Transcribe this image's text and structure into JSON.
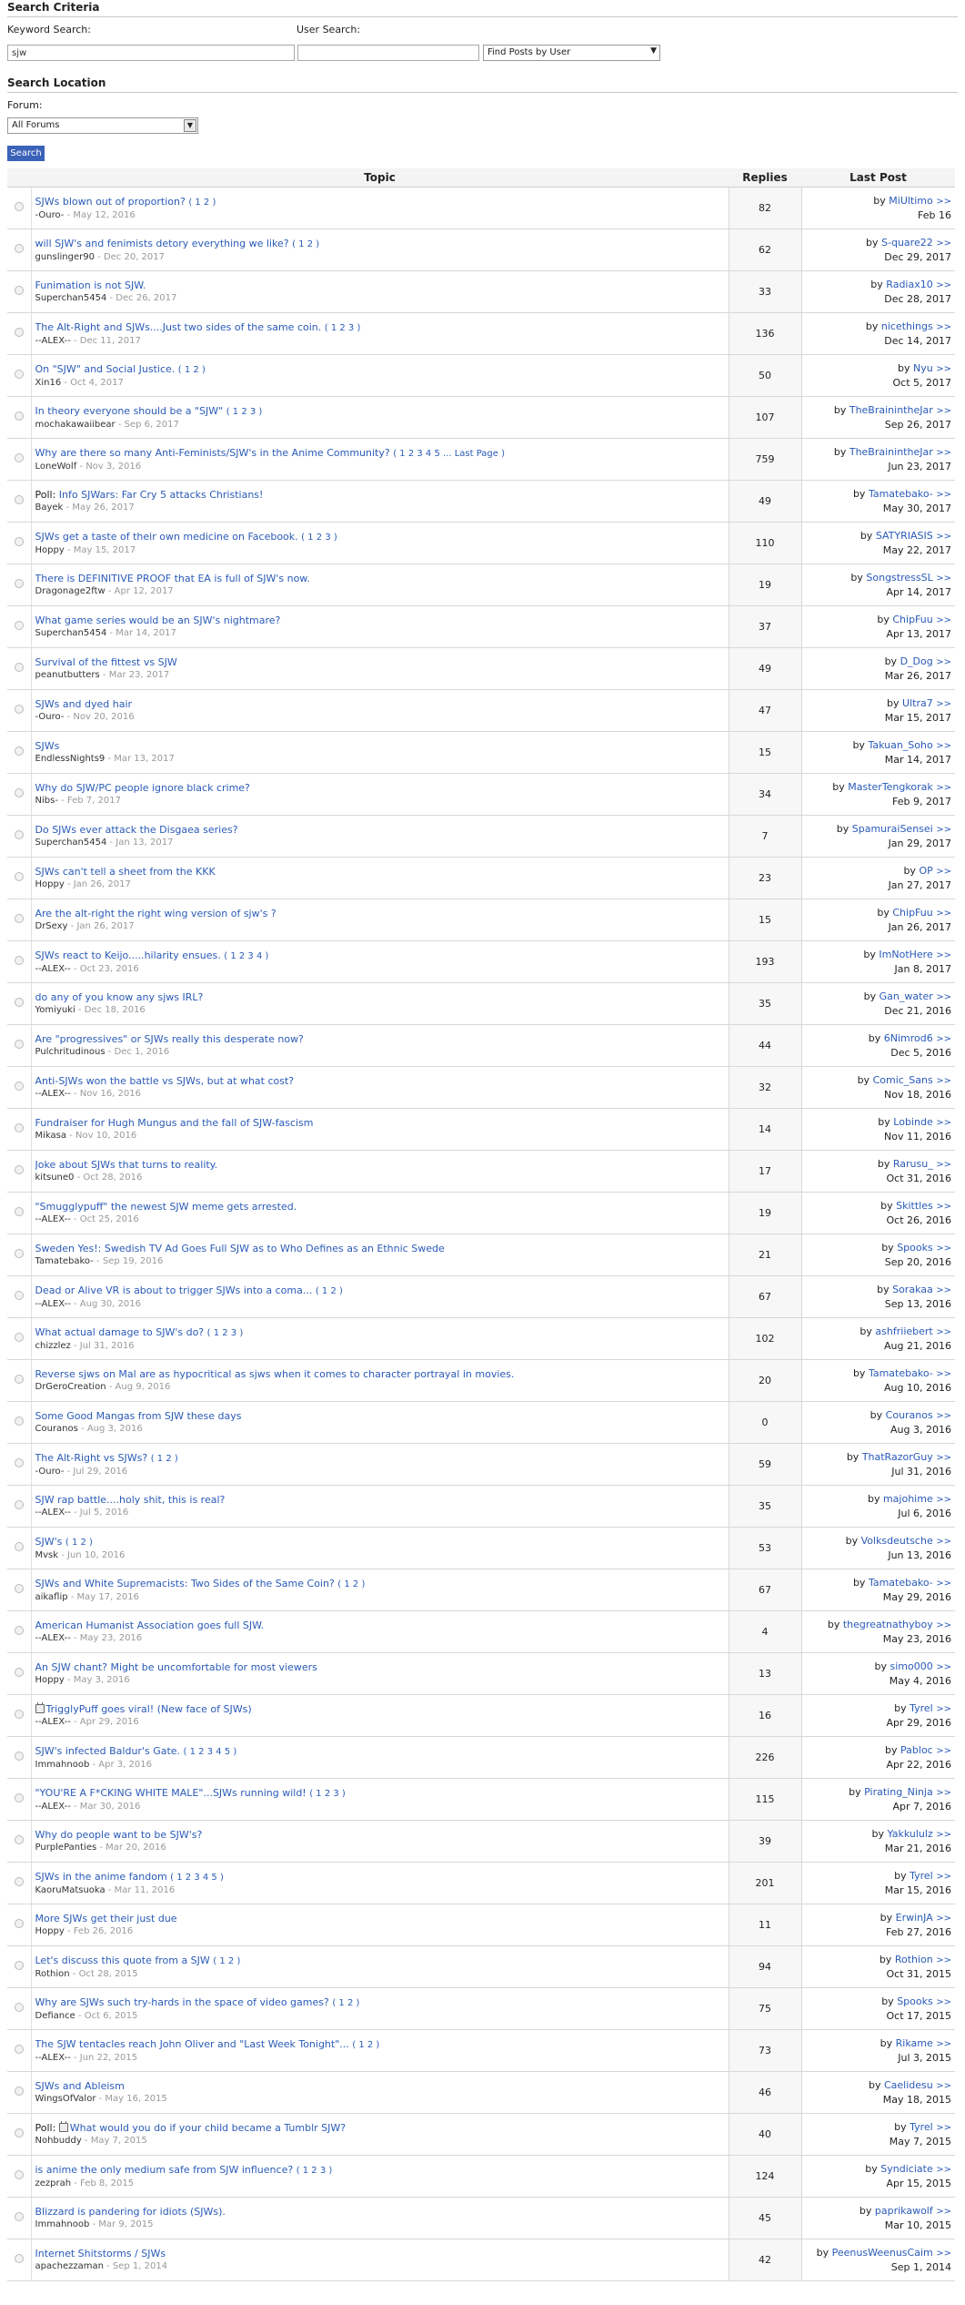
{
  "search": {
    "criteria_title": "Search Criteria",
    "keyword_label": "Keyword Search:",
    "keyword_value": "sjw",
    "user_label": "User Search:",
    "user_value": "",
    "mode_selected": "Find Posts by User",
    "location_title": "Search Location",
    "forum_label": "Forum:",
    "forum_selected": "All Forums",
    "button": "Search"
  },
  "table": {
    "headers": {
      "topic": "Topic",
      "replies": "Replies",
      "last_post": "Last Post"
    }
  },
  "topics": [
    {
      "prefix": "",
      "locked": false,
      "title": "SJWs blown out of proportion?",
      "pages": "( 1 2 )",
      "author": "-Ouro-",
      "date": "May 12, 2016",
      "replies": "82",
      "last_user": "MiUltimo",
      "last_date": "Feb 16"
    },
    {
      "prefix": "",
      "locked": false,
      "title": "will SJW's and fenimists detory everything we like?",
      "pages": "( 1 2 )",
      "author": "gunslinger90",
      "date": "Dec 20, 2017",
      "replies": "62",
      "last_user": "S-quare22",
      "last_date": "Dec 29, 2017"
    },
    {
      "prefix": "",
      "locked": false,
      "title": "Funimation is not SJW.",
      "pages": "",
      "author": "Superchan5454",
      "date": "Dec 26, 2017",
      "replies": "33",
      "last_user": "Radiax10",
      "last_date": "Dec 28, 2017"
    },
    {
      "prefix": "",
      "locked": false,
      "title": "The Alt-Right and SJWs....Just two sides of the same coin.",
      "pages": "( 1 2 3 )",
      "author": "--ALEX--",
      "date": "Dec 11, 2017",
      "replies": "136",
      "last_user": "nicethings",
      "last_date": "Dec 14, 2017"
    },
    {
      "prefix": "",
      "locked": false,
      "title": "On \"SJW\" and Social Justice.",
      "pages": "( 1 2 )",
      "author": "Xin16",
      "date": "Oct 4, 2017",
      "replies": "50",
      "last_user": "Nyu",
      "last_date": "Oct 5, 2017"
    },
    {
      "prefix": "",
      "locked": false,
      "title": "In theory everyone should be a \"SJW\"",
      "pages": "( 1 2 3 )",
      "author": "mochakawaiibear",
      "date": "Sep 6, 2017",
      "replies": "107",
      "last_user": "TheBrainintheJar",
      "last_date": "Sep 26, 2017"
    },
    {
      "prefix": "",
      "locked": false,
      "title": "Why are there so many Anti-Feminists/SJW's in the Anime Community?",
      "pages": "( 1 2 3 4 5 ... Last Page )",
      "author": "LoneWolf",
      "date": "Nov 3, 2016",
      "replies": "759",
      "last_user": "TheBrainintheJar",
      "last_date": "Jun 23, 2017"
    },
    {
      "prefix": "Poll:",
      "locked": false,
      "title": "Info SJWars: Far Cry 5 attacks Christians!",
      "pages": "",
      "author": "Bayek",
      "date": "May 26, 2017",
      "replies": "49",
      "last_user": "Tamatebako-",
      "last_date": "May 30, 2017"
    },
    {
      "prefix": "",
      "locked": false,
      "title": "SJWs get a taste of their own medicine on Facebook.",
      "pages": "( 1 2 3 )",
      "author": "Hoppy",
      "date": "May 15, 2017",
      "replies": "110",
      "last_user": "SATYRIASIS",
      "last_date": "May 22, 2017"
    },
    {
      "prefix": "",
      "locked": false,
      "title": "There is DEFINITIVE PROOF that EA is full of SJW's now.",
      "pages": "",
      "author": "Dragonage2ftw",
      "date": "Apr 12, 2017",
      "replies": "19",
      "last_user": "SongstressSL",
      "last_date": "Apr 14, 2017"
    },
    {
      "prefix": "",
      "locked": false,
      "title": "What game series would be an SJW's nightmare?",
      "pages": "",
      "author": "Superchan5454",
      "date": "Mar 14, 2017",
      "replies": "37",
      "last_user": "ChipFuu",
      "last_date": "Apr 13, 2017"
    },
    {
      "prefix": "",
      "locked": false,
      "title": "Survival of the fittest vs SJW",
      "pages": "",
      "author": "peanutbutters",
      "date": "Mar 23, 2017",
      "replies": "49",
      "last_user": "D_Dog",
      "last_date": "Mar 26, 2017"
    },
    {
      "prefix": "",
      "locked": false,
      "title": "SJWs and dyed hair",
      "pages": "",
      "author": "-Ouro-",
      "date": "Nov 20, 2016",
      "replies": "47",
      "last_user": "Ultra7",
      "last_date": "Mar 15, 2017"
    },
    {
      "prefix": "",
      "locked": false,
      "title": "SJWs",
      "pages": "",
      "author": "EndlessNights9",
      "date": "Mar 13, 2017",
      "replies": "15",
      "last_user": "Takuan_Soho",
      "last_date": "Mar 14, 2017"
    },
    {
      "prefix": "",
      "locked": false,
      "title": "Why do SJW/PC people ignore black crime?",
      "pages": "",
      "author": "Nibs-",
      "date": "Feb 7, 2017",
      "replies": "34",
      "last_user": "MasterTengkorak",
      "last_date": "Feb 9, 2017"
    },
    {
      "prefix": "",
      "locked": false,
      "title": "Do SJWs ever attack the Disgaea series?",
      "pages": "",
      "author": "Superchan5454",
      "date": "Jan 13, 2017",
      "replies": "7",
      "last_user": "SpamuraiSensei",
      "last_date": "Jan 29, 2017"
    },
    {
      "prefix": "",
      "locked": false,
      "title": "SJWs can't tell a sheet from the KKK",
      "pages": "",
      "author": "Hoppy",
      "date": "Jan 26, 2017",
      "replies": "23",
      "last_user": "OP",
      "last_date": "Jan 27, 2017"
    },
    {
      "prefix": "",
      "locked": false,
      "title": "Are the alt-right the right wing version of sjw's ?",
      "pages": "",
      "author": "DrSexy",
      "date": "Jan 26, 2017",
      "replies": "15",
      "last_user": "ChipFuu",
      "last_date": "Jan 26, 2017"
    },
    {
      "prefix": "",
      "locked": false,
      "title": "SJWs react to Keijo.....hilarity ensues.",
      "pages": "( 1 2 3 4 )",
      "author": "--ALEX--",
      "date": "Oct 23, 2016",
      "replies": "193",
      "last_user": "ImNotHere",
      "last_date": "Jan 8, 2017"
    },
    {
      "prefix": "",
      "locked": false,
      "title": "do any of you know any sjws IRL?",
      "pages": "",
      "author": "Yomiyuki",
      "date": "Dec 18, 2016",
      "replies": "35",
      "last_user": "Gan_water",
      "last_date": "Dec 21, 2016"
    },
    {
      "prefix": "",
      "locked": false,
      "title": "Are \"progressives\" or SJWs really this desperate now?",
      "pages": "",
      "author": "Pulchritudinous",
      "date": "Dec 1, 2016",
      "replies": "44",
      "last_user": "6Nimrod6",
      "last_date": "Dec 5, 2016"
    },
    {
      "prefix": "",
      "locked": false,
      "title": "Anti-SJWs won the battle vs SJWs, but at what cost?",
      "pages": "",
      "author": "--ALEX--",
      "date": "Nov 16, 2016",
      "replies": "32",
      "last_user": "Comic_Sans",
      "last_date": "Nov 18, 2016"
    },
    {
      "prefix": "",
      "locked": false,
      "title": "Fundraiser for Hugh Mungus and the fall of SJW-fascism",
      "pages": "",
      "author": "Mikasa",
      "date": "Nov 10, 2016",
      "replies": "14",
      "last_user": "Lobinde",
      "last_date": "Nov 11, 2016"
    },
    {
      "prefix": "",
      "locked": false,
      "title": "Joke about SJWs that turns to reality.",
      "pages": "",
      "author": "kitsune0",
      "date": "Oct 28, 2016",
      "replies": "17",
      "last_user": "Rarusu_",
      "last_date": "Oct 31, 2016"
    },
    {
      "prefix": "",
      "locked": false,
      "title": "\"Smugglypuff\" the newest SJW meme gets arrested.",
      "pages": "",
      "author": "--ALEX--",
      "date": "Oct 25, 2016",
      "replies": "19",
      "last_user": "Skittles",
      "last_date": "Oct 26, 2016"
    },
    {
      "prefix": "",
      "locked": false,
      "title": "Sweden Yes!: Swedish TV Ad Goes Full SJW as to Who Defines as an Ethnic Swede",
      "pages": "",
      "author": "Tamatebako-",
      "date": "Sep 19, 2016",
      "replies": "21",
      "last_user": "Spooks",
      "last_date": "Sep 20, 2016"
    },
    {
      "prefix": "",
      "locked": false,
      "title": "Dead or Alive VR is about to trigger SJWs into a coma...",
      "pages": "( 1 2 )",
      "author": "--ALEX--",
      "date": "Aug 30, 2016",
      "replies": "67",
      "last_user": "Sorakaa",
      "last_date": "Sep 13, 2016"
    },
    {
      "prefix": "",
      "locked": false,
      "title": "What actual damage to SJW's do?",
      "pages": "( 1 2 3 )",
      "author": "chizzlez",
      "date": "Jul 31, 2016",
      "replies": "102",
      "last_user": "ashfriiebert",
      "last_date": "Aug 21, 2016"
    },
    {
      "prefix": "",
      "locked": false,
      "title": "Reverse sjws on Mal are as hypocritical as sjws when it comes to character portrayal in movies.",
      "pages": "",
      "author": "DrGeroCreation",
      "date": "Aug 9, 2016",
      "replies": "20",
      "last_user": "Tamatebako-",
      "last_date": "Aug 10, 2016"
    },
    {
      "prefix": "",
      "locked": false,
      "title": "Some Good Mangas from SJW these days",
      "pages": "",
      "author": "Couranos",
      "date": "Aug 3, 2016",
      "replies": "0",
      "last_user": "Couranos",
      "last_date": "Aug 3, 2016"
    },
    {
      "prefix": "",
      "locked": false,
      "title": "The Alt-Right vs SJWs?",
      "pages": "( 1 2 )",
      "author": "-Ouro-",
      "date": "Jul 29, 2016",
      "replies": "59",
      "last_user": "ThatRazorGuy",
      "last_date": "Jul 31, 2016"
    },
    {
      "prefix": "",
      "locked": false,
      "title": "SJW rap battle....holy shit, this is real?",
      "pages": "",
      "author": "--ALEX--",
      "date": "Jul 5, 2016",
      "replies": "35",
      "last_user": "majohime",
      "last_date": "Jul 6, 2016"
    },
    {
      "prefix": "",
      "locked": false,
      "title": "SJW's",
      "pages": "( 1 2 )",
      "author": "Mvsk",
      "date": "Jun 10, 2016",
      "replies": "53",
      "last_user": "Volksdeutsche",
      "last_date": "Jun 13, 2016"
    },
    {
      "prefix": "",
      "locked": false,
      "title": "SJWs and White Supremacists: Two Sides of the Same Coin?",
      "pages": "( 1 2 )",
      "author": "aikaflip",
      "date": "May 17, 2016",
      "replies": "67",
      "last_user": "Tamatebako-",
      "last_date": "May 29, 2016"
    },
    {
      "prefix": "",
      "locked": false,
      "title": "American Humanist Association goes full SJW.",
      "pages": "",
      "author": "--ALEX--",
      "date": "May 23, 2016",
      "replies": "4",
      "last_user": "thegreatnathyboy",
      "last_date": "May 23, 2016"
    },
    {
      "prefix": "",
      "locked": false,
      "title": "An SJW chant? Might be uncomfortable for most viewers",
      "pages": "",
      "author": "Hoppy",
      "date": "May 3, 2016",
      "replies": "13",
      "last_user": "simo000",
      "last_date": "May 4, 2016"
    },
    {
      "prefix": "",
      "locked": true,
      "title": "TrigglyPuff goes viral! (New face of SJWs)",
      "pages": "",
      "author": "--ALEX--",
      "date": "Apr 29, 2016",
      "replies": "16",
      "last_user": "Tyrel",
      "last_date": "Apr 29, 2016"
    },
    {
      "prefix": "",
      "locked": false,
      "title": "SJW's infected Baldur's Gate.",
      "pages": "( 1 2 3 4 5 )",
      "author": "Immahnoob",
      "date": "Apr 3, 2016",
      "replies": "226",
      "last_user": "Pabloc",
      "last_date": "Apr 22, 2016"
    },
    {
      "prefix": "",
      "locked": false,
      "title": "\"YOU'RE A F*CKING WHITE MALE\"...SJWs running wild!",
      "pages": "( 1 2 3 )",
      "author": "--ALEX--",
      "date": "Mar 30, 2016",
      "replies": "115",
      "last_user": "Pirating_Ninja",
      "last_date": "Apr 7, 2016"
    },
    {
      "prefix": "",
      "locked": false,
      "title": "Why do people want to be SJW's?",
      "pages": "",
      "author": "PurplePanties",
      "date": "Mar 20, 2016",
      "replies": "39",
      "last_user": "Yakkululz",
      "last_date": "Mar 21, 2016"
    },
    {
      "prefix": "",
      "locked": false,
      "title": "SJWs in the anime fandom",
      "pages": "( 1 2 3 4 5 )",
      "author": "KaoruMatsuoka",
      "date": "Mar 11, 2016",
      "replies": "201",
      "last_user": "Tyrel",
      "last_date": "Mar 15, 2016"
    },
    {
      "prefix": "",
      "locked": false,
      "title": "More SJWs get their just due",
      "pages": "",
      "author": "Hoppy",
      "date": "Feb 26, 2016",
      "replies": "11",
      "last_user": "ErwinJA",
      "last_date": "Feb 27, 2016"
    },
    {
      "prefix": "",
      "locked": false,
      "title": "Let's discuss this quote from a SJW",
      "pages": "( 1 2 )",
      "author": "Rothion",
      "date": "Oct 28, 2015",
      "replies": "94",
      "last_user": "Rothion",
      "last_date": "Oct 31, 2015"
    },
    {
      "prefix": "",
      "locked": false,
      "title": "Why are SJWs such try-hards in the space of video games?",
      "pages": "( 1 2 )",
      "author": "Defiance",
      "date": "Oct 6, 2015",
      "replies": "75",
      "last_user": "Spooks",
      "last_date": "Oct 17, 2015"
    },
    {
      "prefix": "",
      "locked": false,
      "title": "The SJW tentacles reach John Oliver and \"Last Week Tonight\"...",
      "pages": "( 1 2 )",
      "author": "--ALEX--",
      "date": "Jun 22, 2015",
      "replies": "73",
      "last_user": "Rikame",
      "last_date": "Jul 3, 2015"
    },
    {
      "prefix": "",
      "locked": false,
      "title": "SJWs and Ableism",
      "pages": "",
      "author": "WingsOfValor",
      "date": "May 16, 2015",
      "replies": "46",
      "last_user": "Caelidesu",
      "last_date": "May 18, 2015"
    },
    {
      "prefix": "Poll:",
      "locked": true,
      "title": "What would you do if your child became a Tumblr SJW?",
      "pages": "",
      "author": "Nohbuddy",
      "date": "May 7, 2015",
      "replies": "40",
      "last_user": "Tyrel",
      "last_date": "May 7, 2015"
    },
    {
      "prefix": "",
      "locked": false,
      "title": "is anime the only medium safe from SJW influence?",
      "pages": "( 1 2 3 )",
      "author": "zezprah",
      "date": "Feb 8, 2015",
      "replies": "124",
      "last_user": "Syndiciate",
      "last_date": "Apr 15, 2015"
    },
    {
      "prefix": "",
      "locked": false,
      "title": "Blizzard is pandering for idiots (SJWs).",
      "pages": "",
      "author": "Immahnoob",
      "date": "Mar 9, 2015",
      "replies": "45",
      "last_user": "paprikawolf",
      "last_date": "Mar 10, 2015"
    },
    {
      "prefix": "",
      "locked": false,
      "title": "Internet Shitstorms / SJWs",
      "pages": "",
      "author": "apachezzaman",
      "date": "Sep 1, 2014",
      "replies": "42",
      "last_user": "PeenusWeenusCaim",
      "last_date": "Sep 1, 2014"
    }
  ],
  "labels": {
    "by": "by",
    "go": ">>",
    "sep": " - "
  }
}
